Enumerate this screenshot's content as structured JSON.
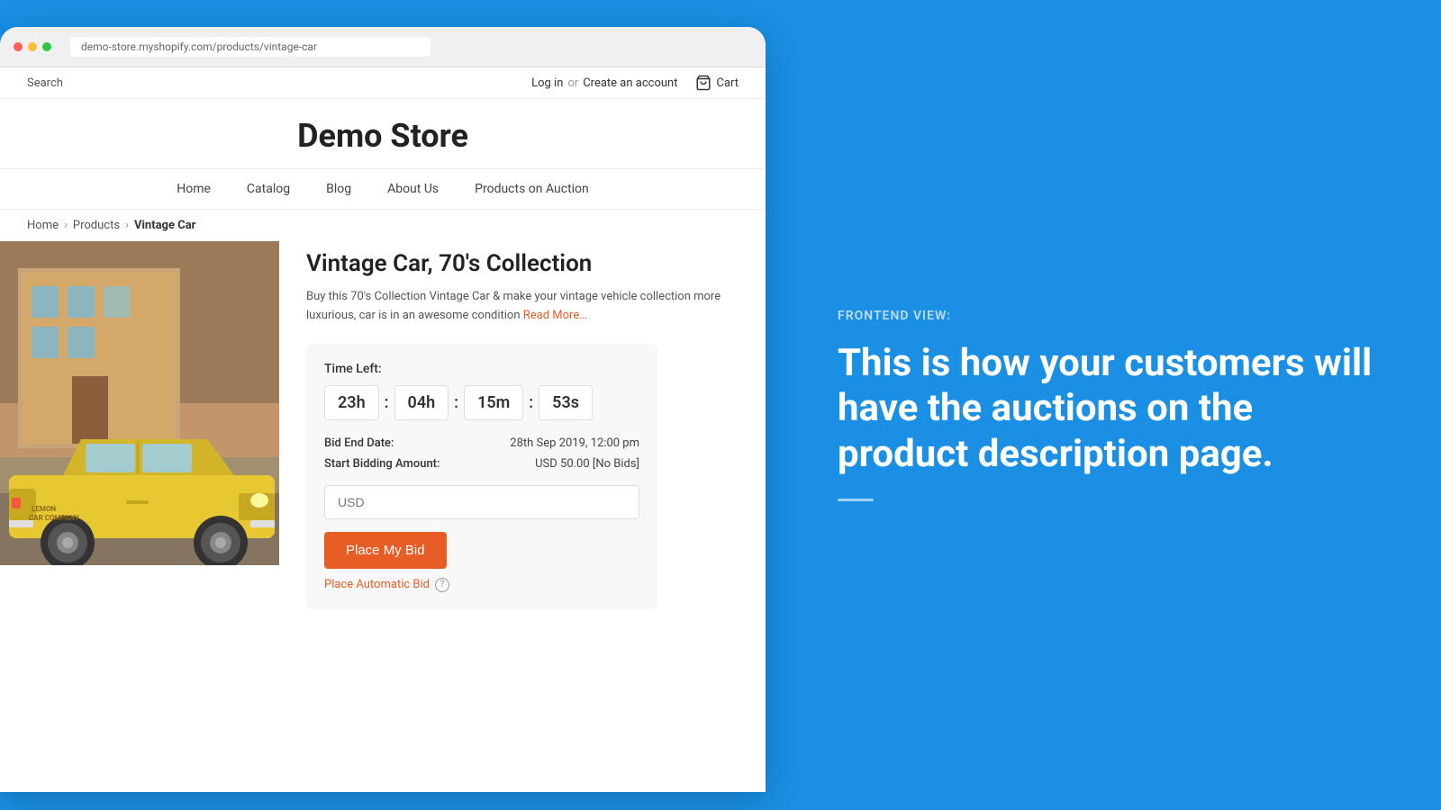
{
  "browser": {
    "address": "demo-store.myshopify.com/products/vintage-car"
  },
  "store": {
    "title": "Demo Store",
    "search_placeholder": "Search",
    "top_bar": {
      "login": "Log in",
      "separator": "or",
      "create_account": "Create an account",
      "cart": "Cart"
    },
    "nav": {
      "items": [
        {
          "label": "Home",
          "href": "#"
        },
        {
          "label": "Catalog",
          "href": "#"
        },
        {
          "label": "Blog",
          "href": "#"
        },
        {
          "label": "About Us",
          "href": "#"
        },
        {
          "label": "Products on Auction",
          "href": "#"
        }
      ]
    },
    "breadcrumb": {
      "home": "Home",
      "products": "Products",
      "current": "Vintage Car"
    },
    "product": {
      "title": "Vintage Car, 70's Collection",
      "description": "Buy this 70's Collection Vintage Car & make your vintage vehicle collection more luxurious, car is in an awesome condition",
      "read_more": "Read More…",
      "auction": {
        "time_left_label": "Time Left:",
        "hours": "23h",
        "minutes_separator1": ":",
        "hours2": "04h",
        "minutes_separator2": ":",
        "minutes": "15m",
        "seconds_separator": ":",
        "seconds": "53s",
        "bid_end_label": "Bid End Date:",
        "bid_end_value": "28th Sep 2019, 12:00 pm",
        "start_bid_label": "Start Bidding Amount:",
        "start_bid_value": "USD 50.00  [No Bids]",
        "input_placeholder": "USD",
        "place_bid_btn": "Place My Bid",
        "auto_bid_label": "Place Automatic Bid",
        "help_icon": "?"
      }
    }
  },
  "right_panel": {
    "label": "FRONTEND VIEW:",
    "heading": "This is how your customers will have the auctions on the product description page."
  }
}
